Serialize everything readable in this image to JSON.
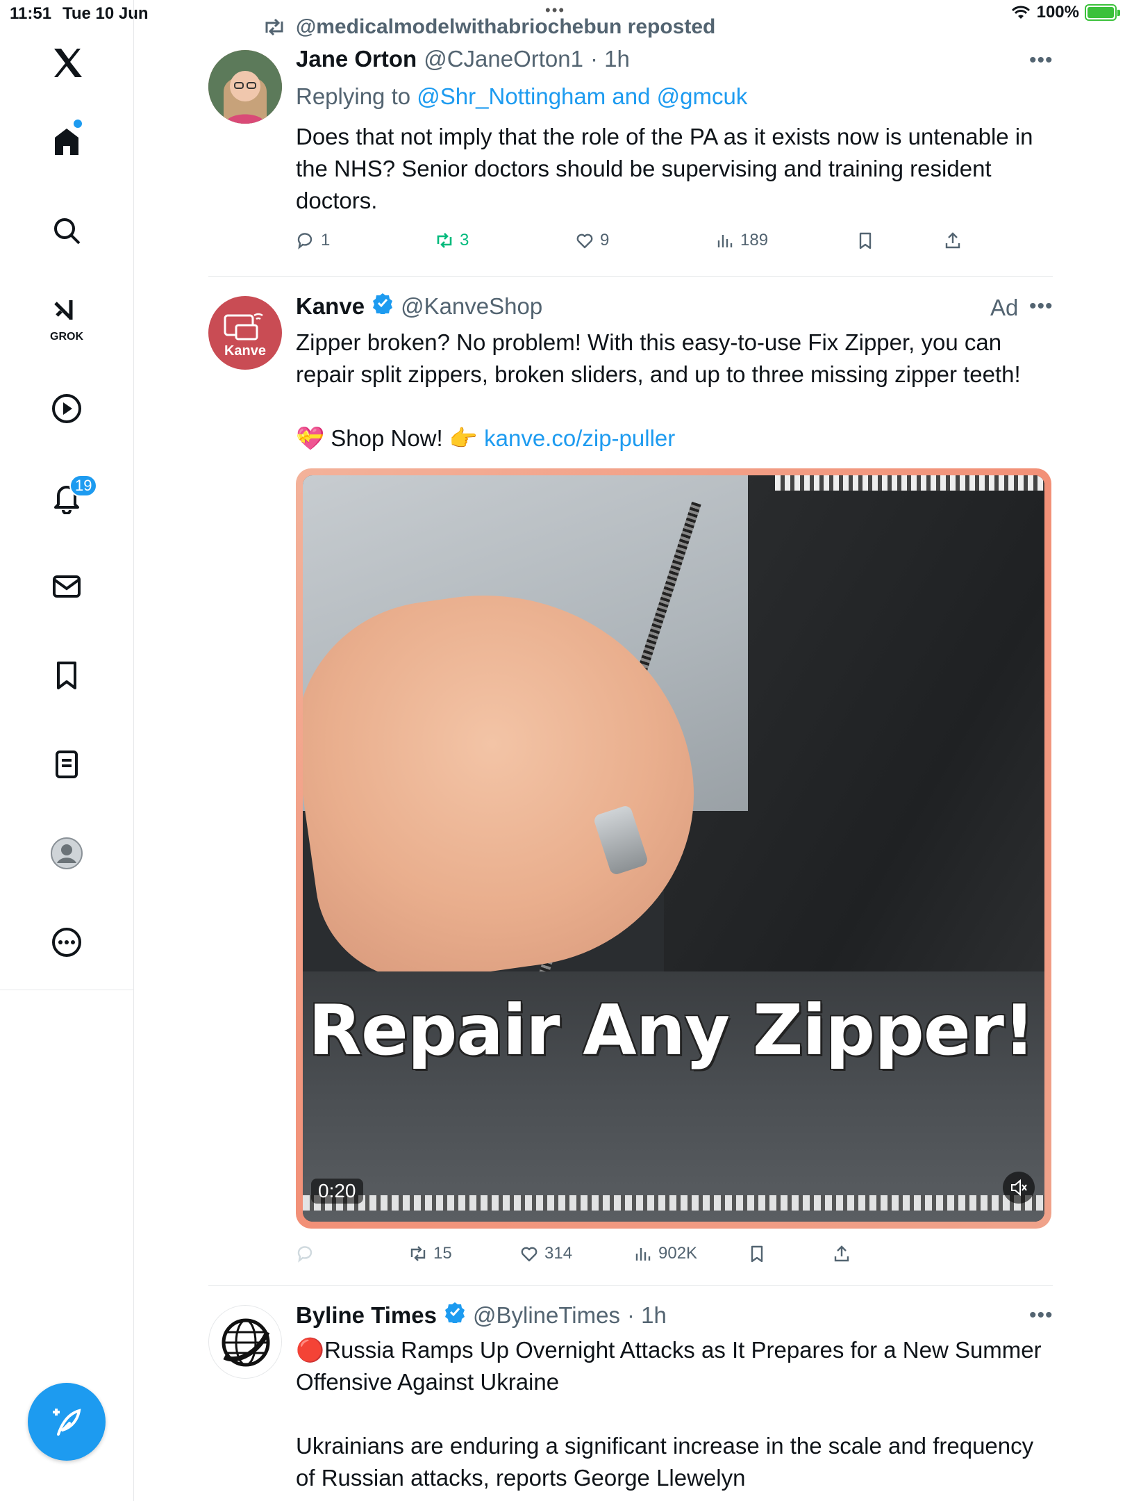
{
  "status_bar": {
    "time": "11:51",
    "date": "Tue 10 Jun",
    "battery": "100%",
    "battery_level": 1.0
  },
  "sidebar": {
    "grok_label": "GROK",
    "notifications_badge": "19",
    "items": [
      "x-logo",
      "home",
      "search",
      "grok",
      "video",
      "notifications",
      "messages",
      "bookmarks",
      "lists",
      "profile",
      "more"
    ]
  },
  "feed": {
    "repost_label": "@medicalmodelwithabriochebun reposted",
    "posts": [
      {
        "name": "Jane Orton",
        "handle": "@CJaneOrton1",
        "time": "· 1h",
        "replying_prefix": "Replying to",
        "replying_to": "@Shr_Nottingham and @gmcuk",
        "text": "Does that not imply that the role of the PA as it exists now is untenable in the NHS? Senior doctors should be supervising and training resident doctors.",
        "replies": "1",
        "reposts": "3",
        "likes": "9",
        "views": "189"
      },
      {
        "name": "Kanve",
        "handle": "@KanveShop",
        "avatar_label": "Kanve",
        "ad_label": "Ad",
        "text": "Zipper broken? No problem! With this easy-to-use Fix Zipper, you can repair split zippers, broken sliders, and up to three missing zipper teeth!",
        "shop_prefix": "💝 Shop Now! 👉",
        "shop_link": "kanve.co/zip-puller",
        "video_caption": "Repair Any Zipper!",
        "video_time": "0:20",
        "replies": "",
        "reposts": "15",
        "likes": "314",
        "views": "902K"
      },
      {
        "name": "Byline Times",
        "handle": "@BylineTimes",
        "time": "· 1h",
        "headline": "🔴Russia Ramps Up Overnight Attacks as It Prepares for a New Summer Offensive Against Ukraine",
        "text": "Ukrainians are enduring a significant increase in the scale and frequency of Russian attacks, reports George Llewelyn"
      }
    ]
  },
  "colors": {
    "accent": "#1d9bf0",
    "repost_green": "#00ba7c",
    "muted": "#536471"
  }
}
